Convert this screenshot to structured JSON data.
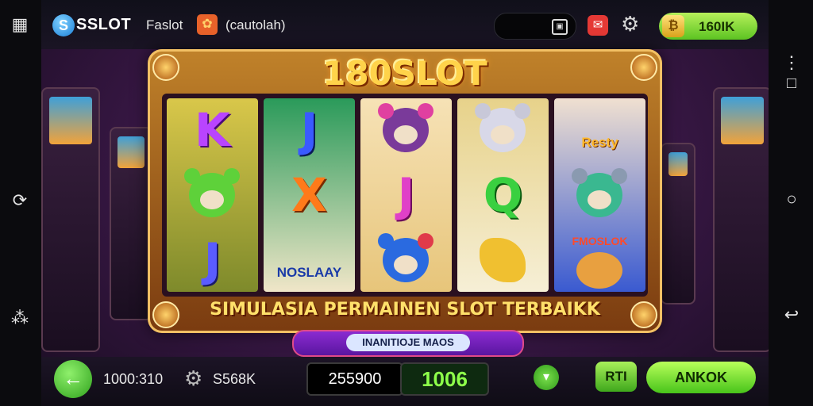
{
  "topbar": {
    "logo_mark": "S",
    "logo_text": "SSLOT",
    "nav_label_1": "Faslot",
    "nav_label_2": "(cautolah)",
    "coin_value": "160IK"
  },
  "game": {
    "title": "180SLOT",
    "reels": [
      [
        "K",
        "mouse-green",
        "coin-J"
      ],
      [
        "J",
        "X",
        "NOSLAAY"
      ],
      [
        "mouse-pink",
        "J",
        "mouse-blue"
      ],
      [
        "mouse-white",
        "Q",
        "banana"
      ],
      [
        "Resty",
        "mouse-teal",
        "FMOSLOK"
      ]
    ],
    "reel_texts": {
      "k": "K",
      "j1": "J",
      "x": "X",
      "j2": "J",
      "q": "Q",
      "j3": "J",
      "noslaay": "NOSLAAY",
      "resty": "Resty",
      "fmoslok": "FMOSLOK"
    },
    "banner": "SIMULASIA PERMAINEN SLOT TERBAIKK",
    "sub_banner": "INANITIOJE MAOS"
  },
  "bottombar": {
    "time": "1000:310",
    "bet": "S568K",
    "balance": "255900",
    "win": "1006",
    "rti_label": "RTI",
    "spin_label": "ANKOK"
  },
  "colors": {
    "accent_green": "#5cc322",
    "title_gold": "#ffd34a",
    "frame": "#c0822a"
  }
}
